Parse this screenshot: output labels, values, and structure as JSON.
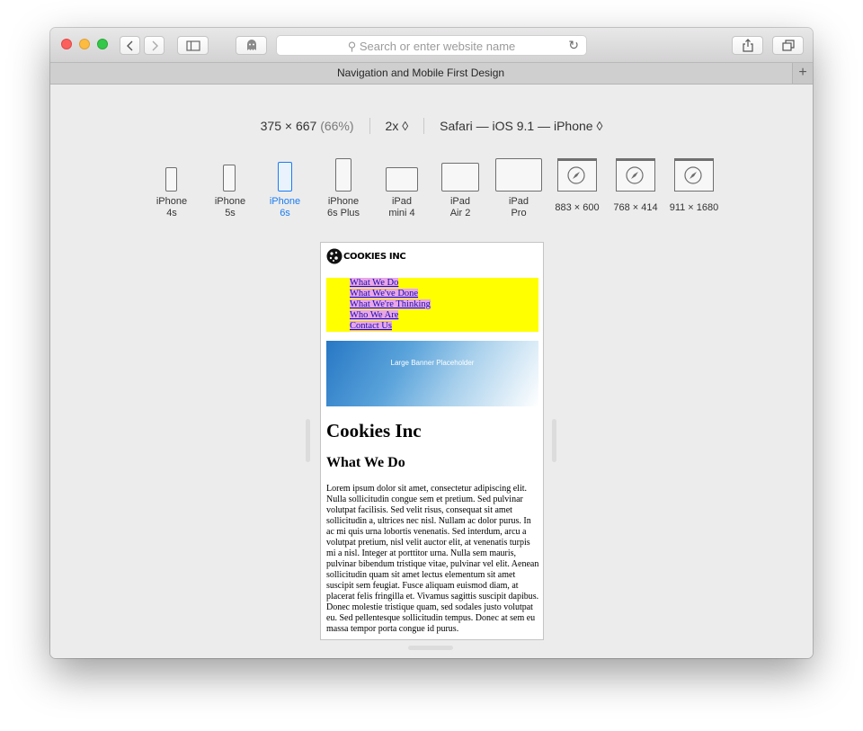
{
  "browser": {
    "address_placeholder": "Search or enter website name",
    "tab_title": "Navigation and Mobile First Design",
    "new_tab": "+"
  },
  "responsive": {
    "resolution": "375 × 667",
    "scale_pct": "(66%)",
    "pixel_ratio": "2x ◊",
    "user_agent": "Safari — iOS 9.1 — iPhone ◊",
    "devices": [
      {
        "line1": "iPhone",
        "line2": "4s",
        "type": "phone",
        "selected": false
      },
      {
        "line1": "iPhone",
        "line2": "5s",
        "type": "phone",
        "selected": false
      },
      {
        "line1": "iPhone",
        "line2": "6s",
        "type": "phone",
        "selected": true
      },
      {
        "line1": "iPhone",
        "line2": "6s Plus",
        "type": "phone",
        "selected": false
      },
      {
        "line1": "iPad",
        "line2": "mini 4",
        "type": "tablet",
        "selected": false
      },
      {
        "line1": "iPad",
        "line2": "Air 2",
        "type": "tablet",
        "selected": false
      },
      {
        "line1": "iPad",
        "line2": "Pro",
        "type": "tablet",
        "selected": false
      },
      {
        "line1": "883 × 600",
        "line2": "",
        "type": "desktop",
        "selected": false
      },
      {
        "line1": "768 × 414",
        "line2": "",
        "type": "desktop",
        "selected": false
      },
      {
        "line1": "911 × 1680",
        "line2": "",
        "type": "desktop",
        "selected": false
      }
    ]
  },
  "site": {
    "logo": "COOKIES INC",
    "nav": [
      "What We Do",
      "What We've Done",
      "What We're Thinking",
      "Who We Are",
      "Contact Us"
    ],
    "banner": "Large Banner Placeholder",
    "h1": "Cookies Inc",
    "h2": "What We Do",
    "paragraph": "Lorem ipsum dolor sit amet, consectetur adipiscing elit. Nulla sollicitudin congue sem et pretium. Sed pulvinar volutpat facilisis. Sed velit risus, consequat sit amet sollicitudin a, ultrices nec nisl. Nullam ac dolor purus. In ac mi quis urna lobortis venenatis. Sed interdum, arcu a volutpat pretium, nisl velit auctor elit, at venenatis turpis mi a nisl. Integer at porttitor urna. Nulla sem mauris, pulvinar bibendum tristique vitae, pulvinar vel elit. Aenean sollicitudin quam sit amet lectus elementum sit amet suscipit sem feugiat. Fusce aliquam euismod diam, at placerat felis fringilla et. Vivamus sagittis suscipit dapibus. Donec molestie tristique quam, sed sodales justo volutpat eu. Sed pellentesque sollicitudin tempus. Donec at sem eu massa tempor porta congue id purus."
  },
  "colors": {
    "accent": "#1a7cf2",
    "nav_bg": "#ffff00",
    "link_bg": "#e8a6e8"
  }
}
